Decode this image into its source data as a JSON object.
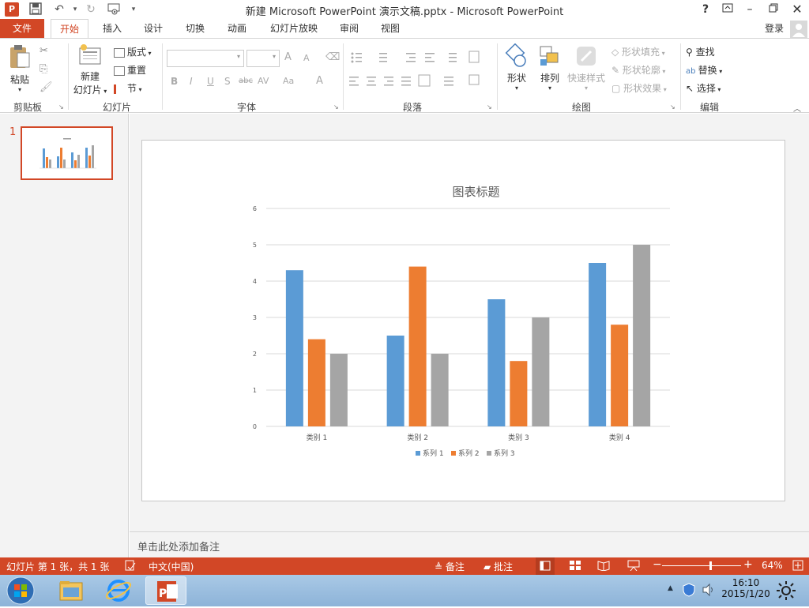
{
  "window": {
    "title": "新建 Microsoft PowerPoint 演示文稿.pptx - Microsoft PowerPoint",
    "help": "?",
    "signin": "登录"
  },
  "tabs": [
    "文件",
    "开始",
    "插入",
    "设计",
    "切换",
    "动画",
    "幻灯片放映",
    "审阅",
    "视图"
  ],
  "ribbon": {
    "clipboard": {
      "paste": "粘贴",
      "group": "剪贴板"
    },
    "slides": {
      "new_slide_1": "新建",
      "new_slide_2": "幻灯片",
      "layout": "版式",
      "reset": "重置",
      "section": "节",
      "group": "幻灯片"
    },
    "font": {
      "group": "字体",
      "bold": "B",
      "italic": "I",
      "underline": "U",
      "shadow": "S",
      "strike": "abc",
      "spacing": "AV",
      "case": "Aa",
      "color": "A",
      "grow": "A",
      "shrink": "A"
    },
    "paragraph": {
      "group": "段落"
    },
    "drawing": {
      "shapes": "形状",
      "arrange": "排列",
      "quick_styles": "快速样式",
      "fill": "形状填充",
      "outline": "形状轮廓",
      "effects": "形状效果",
      "group": "绘图"
    },
    "editing": {
      "find": "查找",
      "replace": "替换",
      "select": "选择",
      "group": "编辑"
    }
  },
  "thumbnail": {
    "number": "1"
  },
  "notes_placeholder": "单击此处添加备注",
  "status": {
    "slide_info": "幻灯片 第 1 张，共 1 张",
    "language": "中文(中国)",
    "notes": "备注",
    "comments": "批注",
    "zoom": "64%",
    "zoom_fraction": 0.64
  },
  "taskbar": {
    "time": "16:10",
    "date": "2015/1/20"
  },
  "colors": {
    "accent": "#d24726",
    "series1": "#5b9bd5",
    "series2": "#ed7d31",
    "series3": "#a5a5a5"
  },
  "chart_data": {
    "type": "bar",
    "title": "图表标题",
    "categories": [
      "类别 1",
      "类别 2",
      "类别 3",
      "类别 4"
    ],
    "series": [
      {
        "name": "系列 1",
        "values": [
          4.3,
          2.5,
          3.5,
          4.5
        ]
      },
      {
        "name": "系列 2",
        "values": [
          2.4,
          4.4,
          1.8,
          2.8
        ]
      },
      {
        "name": "系列 3",
        "values": [
          2,
          2,
          3,
          5
        ]
      }
    ],
    "yticks": [
      "0",
      "1",
      "2",
      "3",
      "4",
      "5",
      "6"
    ],
    "ylim": [
      0,
      6
    ],
    "grid": true,
    "legend": "bottom"
  }
}
